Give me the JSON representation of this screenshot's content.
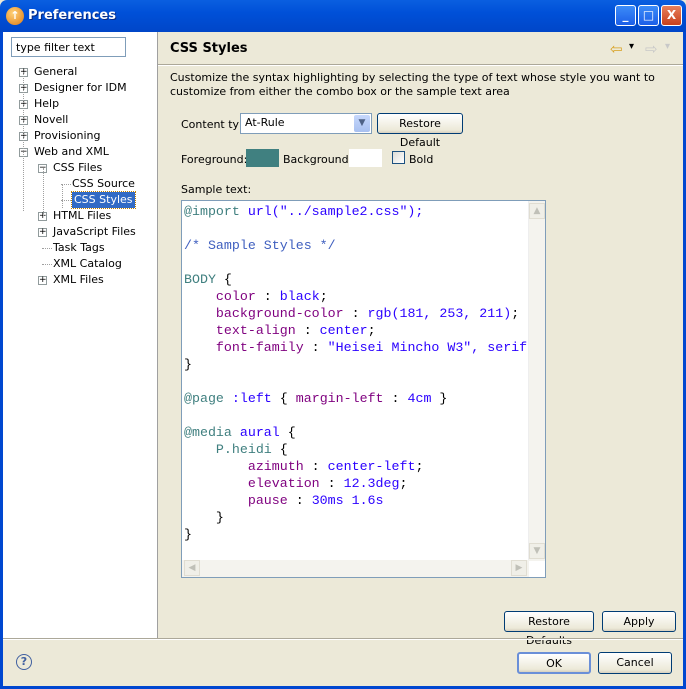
{
  "window": {
    "title": "Preferences",
    "minimize": "_",
    "maximize": "□",
    "close": "X"
  },
  "filter": {
    "placeholder": "type filter text",
    "value": "type filter text"
  },
  "tree": [
    {
      "label": "General",
      "level": 0,
      "expander": "+"
    },
    {
      "label": "Designer for IDM",
      "level": 0,
      "expander": "+"
    },
    {
      "label": "Help",
      "level": 0,
      "expander": "+"
    },
    {
      "label": "Novell",
      "level": 0,
      "expander": "+"
    },
    {
      "label": "Provisioning",
      "level": 0,
      "expander": "+"
    },
    {
      "label": "Web and XML",
      "level": 0,
      "expander": "−"
    },
    {
      "label": "CSS Files",
      "level": 1,
      "expander": "−"
    },
    {
      "label": "CSS Source",
      "level": 2,
      "expander": ""
    },
    {
      "label": "CSS Styles",
      "level": 2,
      "expander": "",
      "selected": true
    },
    {
      "label": "HTML Files",
      "level": 1,
      "expander": "+"
    },
    {
      "label": "JavaScript Files",
      "level": 1,
      "expander": "+"
    },
    {
      "label": "Task Tags",
      "level": 1,
      "expander": ""
    },
    {
      "label": "XML Catalog",
      "level": 1,
      "expander": ""
    },
    {
      "label": "XML Files",
      "level": 1,
      "expander": "+"
    }
  ],
  "page": {
    "title": "CSS Styles",
    "back_icon": "⇦",
    "forward_icon": "⇨",
    "dropdown_icon": "▾",
    "description": "Customize the syntax highlighting by selecting the type of text whose style you want to customize from either the combo box or the sample text area",
    "content_type_label": "Content type:",
    "content_type_value": "At-Rule",
    "restore_default": "Restore Default",
    "foreground_label": "Foreground:",
    "background_label": "Background:",
    "bold_label": "Bold",
    "sample_label": "Sample text:",
    "colors": {
      "foreground": "#408080",
      "background": "#ffffff"
    }
  },
  "code": [
    [
      [
        "@import ",
        "at"
      ],
      [
        "url(\"../sample2.css\");",
        "val"
      ]
    ],
    [],
    [
      [
        "/* Sample Styles */",
        "com"
      ]
    ],
    [],
    [
      [
        "BODY ",
        "sel"
      ],
      [
        "{",
        "p"
      ]
    ],
    [
      [
        "    color",
        "prop"
      ],
      [
        " : ",
        "p"
      ],
      [
        "black",
        "val"
      ],
      [
        ";",
        "p"
      ]
    ],
    [
      [
        "    background-color",
        "prop"
      ],
      [
        " : ",
        "p"
      ],
      [
        "rgb(181, 253, 211)",
        "val"
      ],
      [
        ";",
        "p"
      ]
    ],
    [
      [
        "    text-align",
        "prop"
      ],
      [
        " : ",
        "p"
      ],
      [
        "center",
        "val"
      ],
      [
        ";",
        "p"
      ]
    ],
    [
      [
        "    font-family",
        "prop"
      ],
      [
        " : ",
        "p"
      ],
      [
        "\"Heisei Mincho W3\", serif",
        "val"
      ]
    ],
    [
      [
        "}",
        "p"
      ]
    ],
    [],
    [
      [
        "@page ",
        "at"
      ],
      [
        ":left",
        "val"
      ],
      [
        " { ",
        "p"
      ],
      [
        "margin-left",
        "prop"
      ],
      [
        " : ",
        "p"
      ],
      [
        "4cm",
        "val"
      ],
      [
        " }",
        "p"
      ]
    ],
    [],
    [
      [
        "@media ",
        "at"
      ],
      [
        "aural",
        "val"
      ],
      [
        " {",
        "p"
      ]
    ],
    [
      [
        "    P.heidi ",
        "sel"
      ],
      [
        "{",
        "p"
      ]
    ],
    [
      [
        "        azimuth",
        "prop"
      ],
      [
        " : ",
        "p"
      ],
      [
        "center-left",
        "val"
      ],
      [
        ";",
        "p"
      ]
    ],
    [
      [
        "        elevation",
        "prop"
      ],
      [
        " : ",
        "p"
      ],
      [
        "12.3deg",
        "val"
      ],
      [
        ";",
        "p"
      ]
    ],
    [
      [
        "        pause",
        "prop"
      ],
      [
        " : ",
        "p"
      ],
      [
        "30ms 1.6s",
        "val"
      ]
    ],
    [
      [
        "    }",
        "p"
      ]
    ],
    [
      [
        "}",
        "p"
      ]
    ]
  ],
  "buttons": {
    "restore_defaults": "Restore Defaults",
    "apply": "Apply",
    "ok": "OK",
    "cancel": "Cancel",
    "help": "?"
  }
}
